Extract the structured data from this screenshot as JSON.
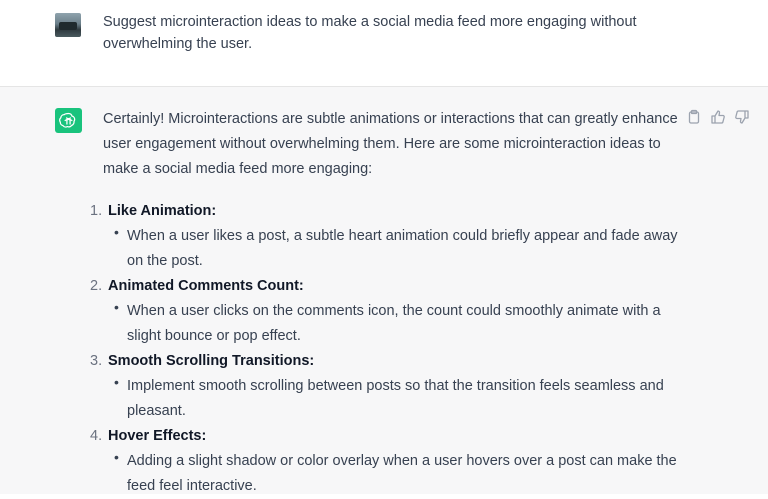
{
  "user_message": {
    "text": "Suggest microinteraction ideas to make a social media feed more engaging without overwhelming the user."
  },
  "assistant_message": {
    "intro": "Certainly! Microinteractions are subtle animations or interactions that can greatly enhance user engagement without overwhelming them. Here are some microinteraction ideas to make a social media feed more engaging:",
    "items": [
      {
        "number": "1.",
        "title": "Like Animation:",
        "detail": "When a user likes a post, a subtle heart animation could briefly appear and fade away on the post."
      },
      {
        "number": "2.",
        "title": "Animated Comments Count:",
        "detail": "When a user clicks on the comments icon, the count could smoothly animate with a slight bounce or pop effect."
      },
      {
        "number": "3.",
        "title": "Smooth Scrolling Transitions:",
        "detail": "Implement smooth scrolling between posts so that the transition feels seamless and pleasant."
      },
      {
        "number": "4.",
        "title": "Hover Effects:",
        "detail": "Adding a slight shadow or color overlay when a user hovers over a post can make the feed feel interactive."
      }
    ],
    "actions": {
      "copy_icon": "clipboard-icon",
      "thumbs_up_icon": "thumbs-up-icon",
      "thumbs_down_icon": "thumbs-down-icon"
    }
  },
  "colors": {
    "accent": "#19c37d",
    "assistant_background": "#f7f7f8",
    "text": "#374151"
  }
}
